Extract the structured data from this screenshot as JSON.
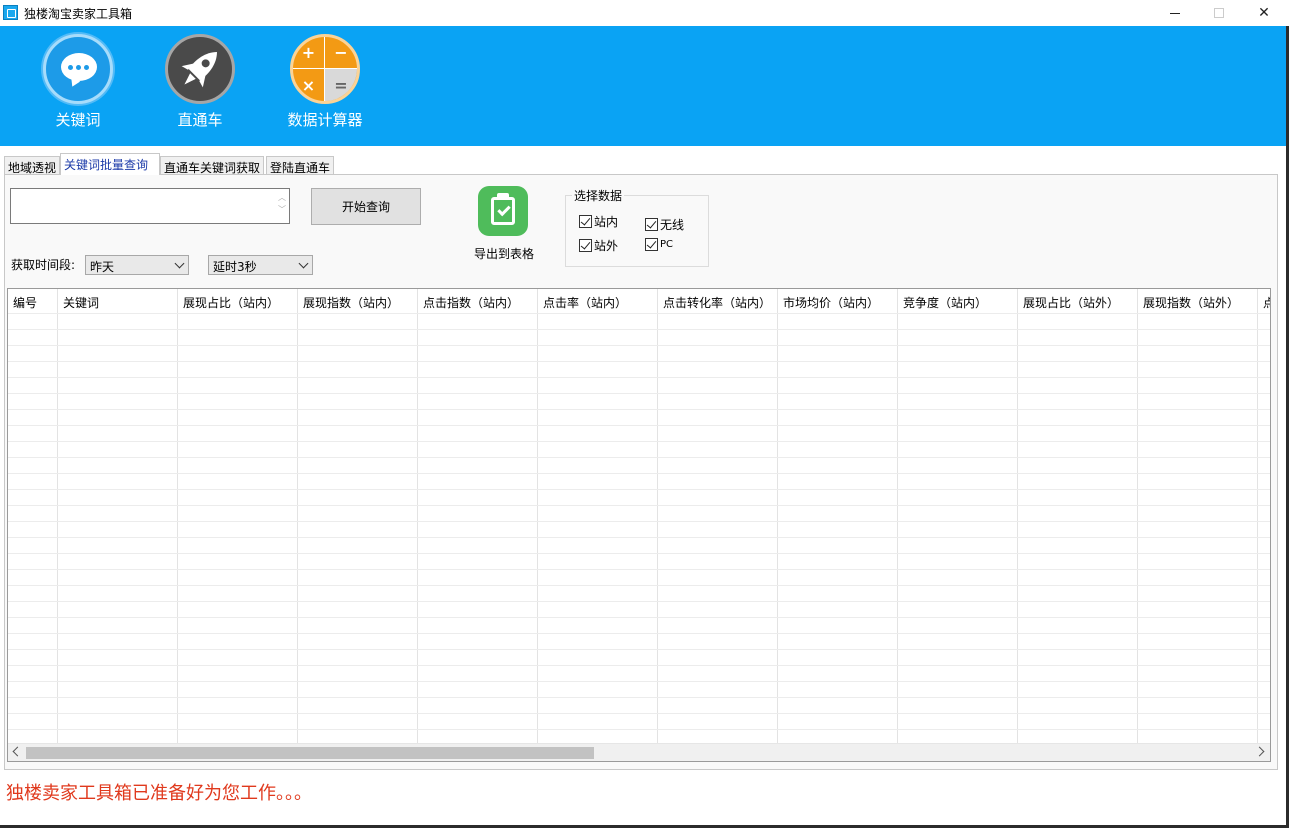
{
  "window": {
    "title": "独楼淘宝卖家工具箱",
    "controls": {
      "minimize": "",
      "maximize": "",
      "close": "✕"
    }
  },
  "toolbar": {
    "keyword_label": "关键词",
    "ztc_label": "直通车",
    "calculator_label": "数据计算器",
    "calculator_symbols": [
      "+",
      "−",
      "×",
      "="
    ]
  },
  "tabs": [
    {
      "label": "地域透视",
      "active": false
    },
    {
      "label": "关键词批量查询",
      "active": true
    },
    {
      "label": "直通车关键词获取",
      "active": false
    },
    {
      "label": "登陆直通车",
      "active": false
    }
  ],
  "query": {
    "keywords_value": "",
    "start_button": "开始查询",
    "export_label": "导出到表格",
    "time_period_label": "获取时间段:",
    "time_period_selected": "昨天",
    "delay_selected": "延时3秒"
  },
  "data_selection": {
    "legend": "选择数据",
    "options": [
      {
        "label": "站内",
        "checked": true
      },
      {
        "label": "无线",
        "checked": true
      },
      {
        "label": "站外",
        "checked": true
      },
      {
        "label": "PC",
        "checked": true
      }
    ]
  },
  "table": {
    "columns": [
      "编号",
      "关键词",
      "展现占比（站内）",
      "展现指数（站内）",
      "点击指数（站内）",
      "点击率（站内）",
      "点击转化率（站内）",
      "市场均价（站内）",
      "竞争度（站内）",
      "展现占比（站外）",
      "展现指数（站外）",
      "点"
    ],
    "rows": []
  },
  "status": "独楼卖家工具箱已准备好为您工作。。。",
  "colors": {
    "banner": "#0aa3f4",
    "status_text": "#e0391d",
    "active_tab_text": "#1b3aa8"
  }
}
